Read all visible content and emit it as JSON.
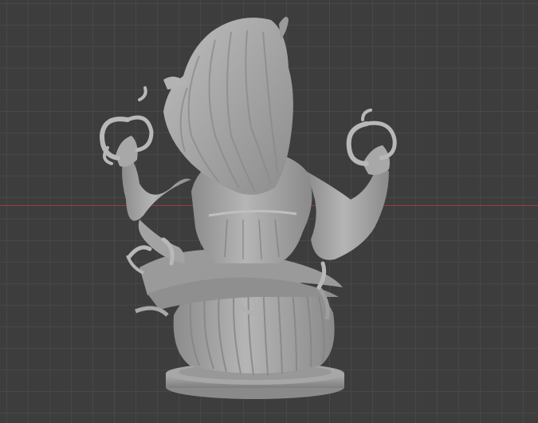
{
  "viewport": {
    "background_color": "#3d3d3d",
    "grid_color": "#474747",
    "x_axis_color": "#9b3b3e",
    "model_base_color": "#a0a0a0",
    "model_shadow_color": "#6f6f6f",
    "model_highlight_color": "#c4c4c4"
  },
  "model": {
    "icon": "sculpt-bust-icon"
  }
}
